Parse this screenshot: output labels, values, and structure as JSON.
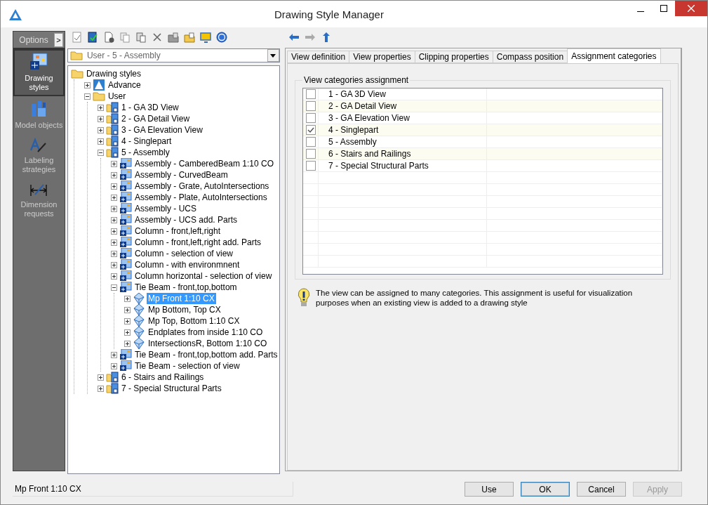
{
  "window": {
    "title": "Drawing Style Manager"
  },
  "sidebar": {
    "header": "Options",
    "expand_label": ">",
    "items": [
      {
        "kind": "styles",
        "label": "Drawing styles",
        "selected": true
      },
      {
        "kind": "objects",
        "label": "Model objects",
        "selected": false
      },
      {
        "kind": "labeling",
        "label": "Labeling strategies",
        "selected": false
      },
      {
        "kind": "dimension",
        "label": "Dimension requests",
        "selected": false
      }
    ]
  },
  "style_picker": {
    "value": "User - 5 - Assembly"
  },
  "tree": {
    "nodes": [
      {
        "kind": "folder",
        "label": "Drawing styles",
        "selected": false,
        "children": [
          {
            "kind": "advance",
            "label": "Advance",
            "expanded": false,
            "selected": false
          },
          {
            "kind": "folder",
            "label": "User",
            "expanded": true,
            "selected": false,
            "children": [
              {
                "kind": "category",
                "label": "1 - GA 3D View",
                "expanded": false,
                "selected": false
              },
              {
                "kind": "category",
                "label": "2 - GA Detail View",
                "expanded": false,
                "selected": false
              },
              {
                "kind": "category",
                "label": "3 - GA Elevation View",
                "expanded": false,
                "selected": false
              },
              {
                "kind": "category",
                "label": "4 - Singlepart",
                "expanded": false,
                "selected": false
              },
              {
                "kind": "category",
                "label": "5 - Assembly",
                "expanded": true,
                "selected": false,
                "children": [
                  {
                    "kind": "style",
                    "label": "Assembly - CamberedBeam 1:10 CO",
                    "expanded": false,
                    "selected": false
                  },
                  {
                    "kind": "style",
                    "label": "Assembly - CurvedBeam",
                    "expanded": false,
                    "selected": false
                  },
                  {
                    "kind": "style",
                    "label": "Assembly - Grate, AutoIntersections",
                    "expanded": false,
                    "selected": false
                  },
                  {
                    "kind": "style",
                    "label": "Assembly - Plate, AutoIntersections",
                    "expanded": false,
                    "selected": false
                  },
                  {
                    "kind": "style",
                    "label": "Assembly - UCS",
                    "expanded": false,
                    "selected": false
                  },
                  {
                    "kind": "style",
                    "label": "Assembly - UCS add. Parts",
                    "expanded": false,
                    "selected": false
                  },
                  {
                    "kind": "style",
                    "label": "Column - front,left,right",
                    "expanded": false,
                    "selected": false
                  },
                  {
                    "kind": "style",
                    "label": "Column - front,left,right add. Parts",
                    "expanded": false,
                    "selected": false
                  },
                  {
                    "kind": "style",
                    "label": "Column - selection of view",
                    "expanded": false,
                    "selected": false
                  },
                  {
                    "kind": "style",
                    "label": "Column - with environmnent",
                    "expanded": false,
                    "selected": false
                  },
                  {
                    "kind": "style",
                    "label": "Column horizontal - selection of view",
                    "expanded": false,
                    "selected": false
                  },
                  {
                    "kind": "style",
                    "label": "Tie Beam - front,top,bottom",
                    "expanded": true,
                    "selected": false,
                    "children": [
                      {
                        "kind": "view",
                        "label": "Mp Front 1:10 CX",
                        "expanded": false,
                        "selected": true
                      },
                      {
                        "kind": "view",
                        "label": "Mp Bottom, Top CX",
                        "expanded": false,
                        "selected": false
                      },
                      {
                        "kind": "view",
                        "label": "Mp Top, Bottom 1:10 CX",
                        "expanded": false,
                        "selected": false
                      },
                      {
                        "kind": "view",
                        "label": "Endplates from inside 1:10 CO",
                        "expanded": false,
                        "selected": false
                      },
                      {
                        "kind": "view",
                        "label": "IntersectionsR, Bottom 1:10 CO",
                        "expanded": false,
                        "selected": false
                      }
                    ]
                  },
                  {
                    "kind": "style",
                    "label": "Tie Beam - front,top,bottom add. Parts",
                    "expanded": false,
                    "selected": false
                  },
                  {
                    "kind": "style",
                    "label": "Tie Beam - selection of view",
                    "expanded": false,
                    "selected": false
                  }
                ]
              },
              {
                "kind": "category",
                "label": "6 - Stairs and Railings",
                "expanded": false,
                "selected": false
              },
              {
                "kind": "category",
                "label": "7 - Special Structural Parts",
                "expanded": false,
                "selected": false
              }
            ]
          }
        ]
      }
    ]
  },
  "tabs": [
    {
      "label": "View definition",
      "selected": false
    },
    {
      "label": "View properties",
      "selected": false
    },
    {
      "label": "Clipping properties",
      "selected": false
    },
    {
      "label": "Compass position",
      "selected": false
    },
    {
      "label": "Assignment categories",
      "selected": true
    }
  ],
  "assignment": {
    "group_title": "View categories assignment",
    "categories": [
      {
        "label": "1 - GA 3D View",
        "checked": false
      },
      {
        "label": "2 - GA Detail View",
        "checked": false
      },
      {
        "label": "3 - GA Elevation View",
        "checked": false
      },
      {
        "label": "4 - Singlepart",
        "checked": true
      },
      {
        "label": "5 - Assembly",
        "checked": false
      },
      {
        "label": "6 - Stairs and Railings",
        "checked": false
      },
      {
        "label": "7 - Special Structural Parts",
        "checked": false
      }
    ],
    "hint": "The view can be assigned to many categories. This assignment is useful for visualization purposes when an existing view is added to a drawing style"
  },
  "status_bar": {
    "text": "Mp Front 1:10 CX"
  },
  "buttons": [
    {
      "label": "Use",
      "default": false,
      "disabled": false
    },
    {
      "label": "OK",
      "default": true,
      "disabled": false
    },
    {
      "label": "Cancel",
      "default": false,
      "disabled": false
    },
    {
      "label": "Apply",
      "default": false,
      "disabled": true
    }
  ]
}
